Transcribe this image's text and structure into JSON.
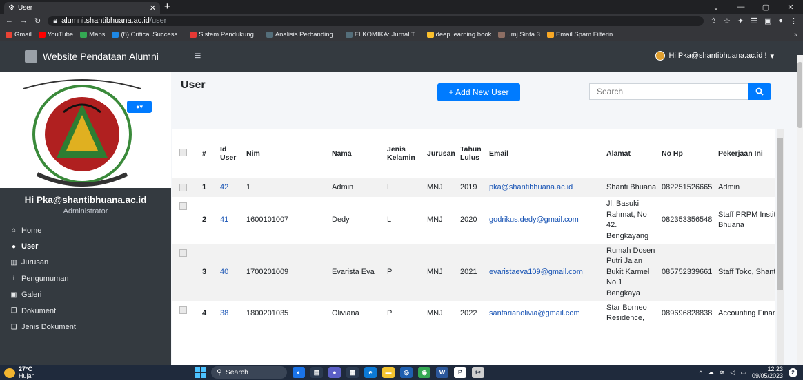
{
  "browser": {
    "tab_title": "User",
    "url_host": "alumni.shantibhuana.ac.id",
    "url_path": "/user",
    "bookmarks": [
      {
        "label": "Gmail",
        "color": "#ea4335"
      },
      {
        "label": "YouTube",
        "color": "#ff0000"
      },
      {
        "label": "Maps",
        "color": "#34a853"
      },
      {
        "label": "(8) Critical Success...",
        "color": "#1e88e5"
      },
      {
        "label": "Sistem Pendukung...",
        "color": "#e53935"
      },
      {
        "label": "Analisis Perbanding...",
        "color": "#546e7a"
      },
      {
        "label": "ELKOMIKA: Jurnal T...",
        "color": "#546e7a"
      },
      {
        "label": "deep learning book",
        "color": "#fbc02d"
      },
      {
        "label": "umj Sinta 3",
        "color": "#8d6e63"
      },
      {
        "label": "Email Spam Filterin...",
        "color": "#f9a825"
      }
    ]
  },
  "app": {
    "brand": "Website Pendataan Alumni",
    "user_menu": "Hi Pka@shantibhuana.ac.id !"
  },
  "sidebar": {
    "greeting": "Hi Pka@shantibhuana.ac.id",
    "role": "Administrator",
    "items": [
      {
        "label": "Home",
        "icon": "home-icon",
        "glyph": "⌂"
      },
      {
        "label": "User",
        "icon": "user-icon",
        "glyph": "●"
      },
      {
        "label": "Jurusan",
        "icon": "university-icon",
        "glyph": "▥"
      },
      {
        "label": "Pengumuman",
        "icon": "info-icon",
        "glyph": "i"
      },
      {
        "label": "Galeri",
        "icon": "image-icon",
        "glyph": "▣"
      },
      {
        "label": "Dokument",
        "icon": "documents-icon",
        "glyph": "❐"
      },
      {
        "label": "Jenis Dokument",
        "icon": "document-type-icon",
        "glyph": "❏"
      }
    ]
  },
  "page": {
    "title": "User",
    "add_button": "+ Add New User",
    "search_placeholder": "Search"
  },
  "table": {
    "headers": [
      "#",
      "Id User",
      "Nim",
      "Nama",
      "Jenis Kelamin",
      "Jurusan",
      "Tahun Lulus",
      "Email",
      "Alamat",
      "No Hp",
      "Pekerjaan Ini"
    ],
    "rows": [
      {
        "no": "1",
        "id": "42",
        "nim": "1",
        "nama": "Admin",
        "jk": "L",
        "jurusan": "MNJ",
        "tahun": "2019",
        "email": "pka@shantibhuana.ac.id",
        "alamat": "Shanti Bhuana",
        "hp": "082251526665",
        "pekerjaan": "Admin"
      },
      {
        "no": "2",
        "id": "41",
        "nim": "1600101007",
        "nama": "Dedy",
        "jk": "L",
        "jurusan": "MNJ",
        "tahun": "2020",
        "email": "godrikus.dedy@gmail.com",
        "alamat": "Jl. Basuki Rahmat, No 42. Bengkayang",
        "hp": "082353356548",
        "pekerjaan": "Staff PRPM Institut Shanti Bhuana"
      },
      {
        "no": "3",
        "id": "40",
        "nim": "1700201009",
        "nama": "Evarista Eva",
        "jk": "P",
        "jurusan": "MNJ",
        "tahun": "2021",
        "email": "evaristaeva109@gmail.com",
        "alamat": "Rumah Dosen Putri Jalan Bukit Karmel No.1 Bengkaya",
        "hp": "085752339661",
        "pekerjaan": "Staff Toko, Shanti Bhuana"
      },
      {
        "no": "4",
        "id": "38",
        "nim": "1800201035",
        "nama": "Oliviana",
        "jk": "P",
        "jurusan": "MNJ",
        "tahun": "2022",
        "email": "santarianolivia@gmail.com",
        "alamat": "Star Borneo Residence,",
        "hp": "089696828838",
        "pekerjaan": "Accounting Finance Staff"
      }
    ]
  },
  "taskbar": {
    "temp": "27°C",
    "weather": "Hujan",
    "search": "Search",
    "time": "12:23",
    "date": "09/05/2023",
    "notifications": "2"
  }
}
